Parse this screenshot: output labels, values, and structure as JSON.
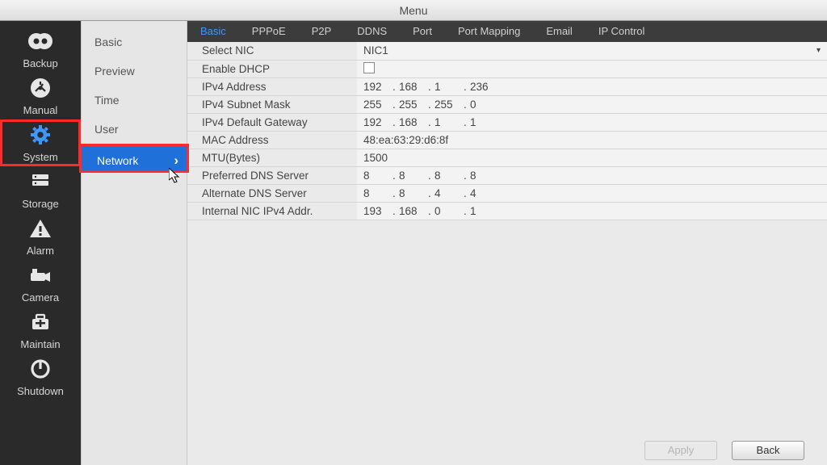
{
  "title": "Menu",
  "left_nav": [
    {
      "name": "backup",
      "label": "Backup"
    },
    {
      "name": "manual",
      "label": "Manual"
    },
    {
      "name": "system",
      "label": "System",
      "highlight": true
    },
    {
      "name": "storage",
      "label": "Storage"
    },
    {
      "name": "alarm",
      "label": "Alarm"
    },
    {
      "name": "camera",
      "label": "Camera"
    },
    {
      "name": "maintain",
      "label": "Maintain"
    },
    {
      "name": "shutdown",
      "label": "Shutdown"
    }
  ],
  "subnav": [
    "Basic",
    "Preview",
    "Time",
    "User",
    "Network"
  ],
  "subnav_active": 4,
  "tabs": [
    "Basic",
    "PPPoE",
    "P2P",
    "DDNS",
    "Port",
    "Port Mapping",
    "Email",
    "IP Control"
  ],
  "tab_active": 0,
  "fields": [
    {
      "label": "Select NIC",
      "type": "select",
      "value": "NIC1"
    },
    {
      "label": "Enable DHCP",
      "type": "checkbox",
      "value": false
    },
    {
      "label": "IPv4 Address",
      "type": "ip",
      "value": [
        "192",
        "168",
        "1",
        "236"
      ]
    },
    {
      "label": "IPv4 Subnet Mask",
      "type": "ip",
      "value": [
        "255",
        "255",
        "255",
        "0"
      ]
    },
    {
      "label": "IPv4 Default Gateway",
      "type": "ip",
      "value": [
        "192",
        "168",
        "1",
        "1"
      ]
    },
    {
      "label": "MAC Address",
      "type": "text",
      "value": "48:ea:63:29:d6:8f"
    },
    {
      "label": "MTU(Bytes)",
      "type": "text",
      "value": "1500"
    },
    {
      "label": "Preferred DNS Server",
      "type": "ip",
      "value": [
        "8",
        "8",
        "8",
        "8"
      ]
    },
    {
      "label": "Alternate DNS Server",
      "type": "ip",
      "value": [
        "8",
        "8",
        "4",
        "4"
      ]
    },
    {
      "label": "Internal NIC IPv4 Addr.",
      "type": "ip",
      "value": [
        "193",
        "168",
        "0",
        "1"
      ]
    }
  ],
  "buttons": {
    "apply": "Apply",
    "back": "Back"
  }
}
